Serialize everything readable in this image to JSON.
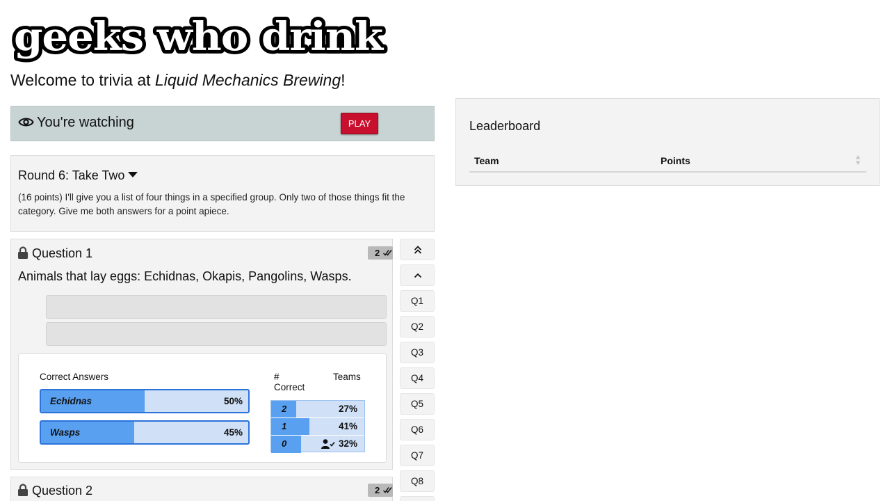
{
  "header": {
    "logo_text": "geeks who drink",
    "welcome_prefix": "Welcome to trivia at ",
    "venue": "Liquid Mechanics Brewing",
    "welcome_suffix": "!"
  },
  "watch_bar": {
    "status": "You're watching",
    "play_label": "PLAY",
    "play_color": "#c8102e"
  },
  "leaderboard": {
    "title": "Leaderboard",
    "columns": [
      "Team",
      "Points"
    ]
  },
  "round": {
    "title": "Round 6: Take Two",
    "description": "(16 points) I'll give you a list of four things in a specified group. Only two of those things fit the category. Give me both answers for a point apiece."
  },
  "questions": [
    {
      "title": "Question 1",
      "badge": "2",
      "text": "Animals that lay eggs: Echidnas, Okapis, Pangolins, Wasps.",
      "stats": {
        "correct_label": "Correct Answers",
        "answers": [
          {
            "name": "Echidnas",
            "pct_label": "50%",
            "pct": 50
          },
          {
            "name": "Wasps",
            "pct_label": "45%",
            "pct": 45
          }
        ],
        "num_correct_label": "# Correct",
        "teams_label": "Teams",
        "distribution": [
          {
            "n": "2",
            "pct_label": "27%",
            "pct": 27
          },
          {
            "n": "1",
            "pct_label": "41%",
            "pct": 41
          },
          {
            "n": "0",
            "pct_label": "32%",
            "pct": 32
          }
        ]
      }
    },
    {
      "title": "Question 2",
      "badge": "2"
    }
  ],
  "nav": {
    "buttons": [
      "Q1",
      "Q2",
      "Q3",
      "Q4",
      "Q5",
      "Q6",
      "Q7",
      "Q8"
    ],
    "icons": [
      "double-chevron-up-icon",
      "chevron-up-icon"
    ]
  },
  "colors": {
    "accent_blue": "#5aa0f0",
    "accent_light_blue": "#cfe0f7",
    "watch_bar_bg": "#c8d4d4"
  }
}
